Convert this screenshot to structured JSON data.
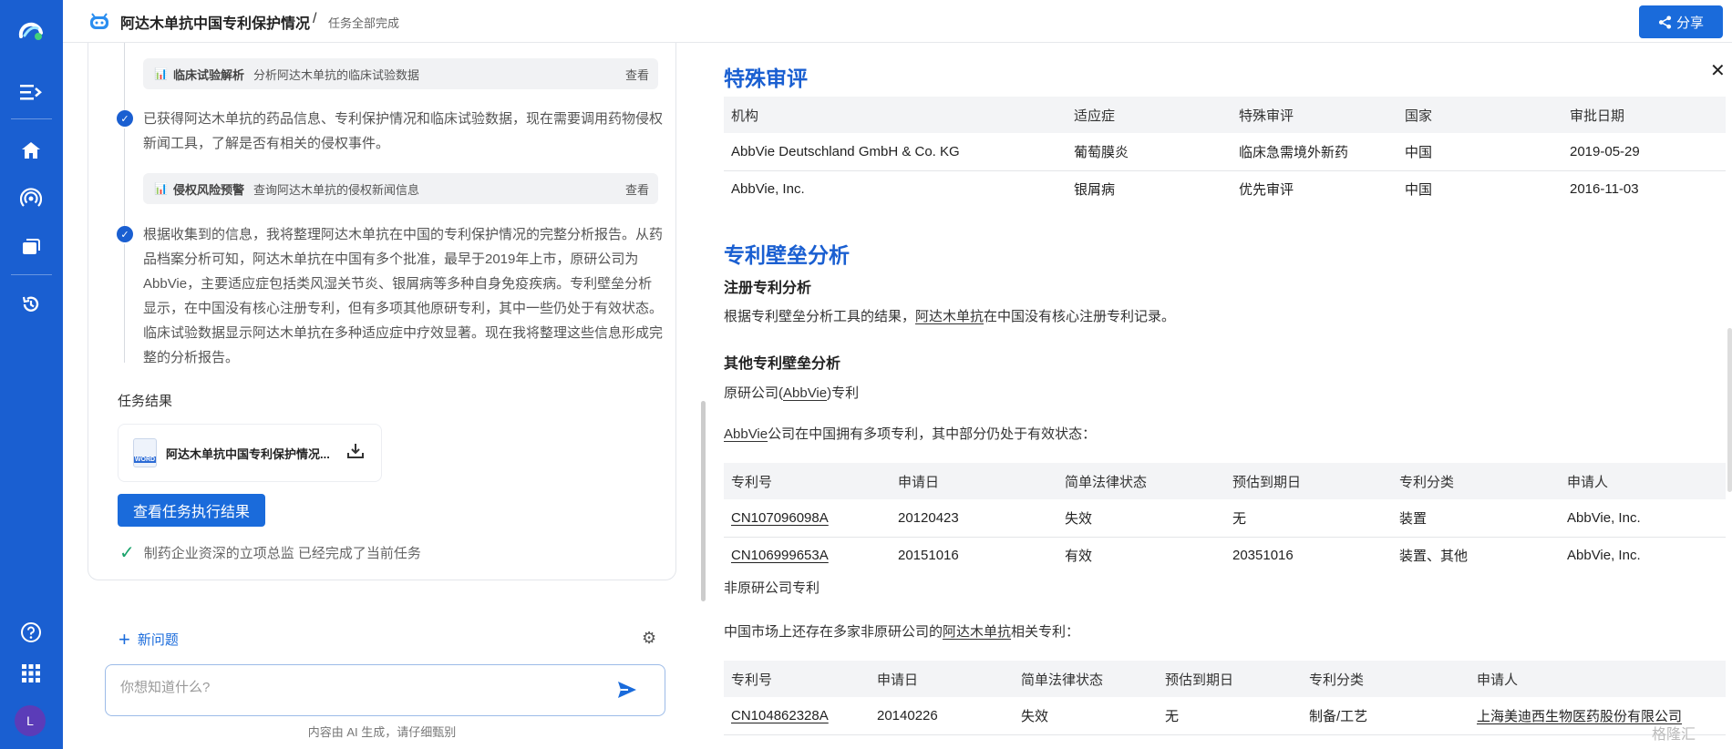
{
  "header": {
    "title": "阿达木单抗中国专利保护情况",
    "separator": "/",
    "status": "任务全部完成",
    "share_label": "分享"
  },
  "sidebar": {
    "items": [
      {
        "icon": "logo-icon"
      },
      {
        "icon": "expand-sidebar-icon"
      },
      {
        "icon": "home-icon"
      },
      {
        "icon": "broadcast-icon"
      },
      {
        "icon": "folders-icon"
      },
      {
        "icon": "history-icon"
      },
      {
        "icon": "help-icon"
      },
      {
        "icon": "apps-grid-icon"
      }
    ],
    "avatar_letter": "L"
  },
  "left": {
    "tool1": {
      "name": "临床试验解析",
      "desc": "分析阿达木单抗的临床试验数据",
      "view": "查看"
    },
    "step1": "已获得阿达木单抗的药品信息、专利保护情况和临床试验数据，现在需要调用药物侵权新闻工具，了解是否有相关的侵权事件。",
    "tool2": {
      "name": "侵权风险预警",
      "desc": "查询阿达木单抗的侵权新闻信息",
      "view": "查看"
    },
    "step2": "根据收集到的信息，我将整理阿达木单抗在中国的专利保护情况的完整分析报告。从药品档案分析可知，阿达木单抗在中国有多个批准，最早于2019年上市，原研公司为AbbVie，主要适应症包括类风湿关节炎、银屑病等多种自身免疫疾病。专利壁垒分析显示，在中国没有核心注册专利，但有多项其他原研专利，其中一些仍处于有效状态。临床试验数据显示阿达木单抗在多种适应症中疗效显著。现在我将整理这些信息形成完整的分析报告。",
    "result_label": "任务结果",
    "file_name": "阿达木单抗中国专利保护情况...",
    "file_type": "WORD",
    "view_result_button": "查看任务执行结果",
    "done_text": "制药企业资深的立项总监 已经完成了当前任务"
  },
  "chat": {
    "new_question": "新问题",
    "placeholder": "你想知道什么?",
    "disclaimer": "内容由 AI 生成，请仔细甄别"
  },
  "report": {
    "special_review_title": "特殊审评",
    "special_review_headers": [
      "机构",
      "适应症",
      "特殊审评",
      "国家",
      "审批日期"
    ],
    "special_review_rows": [
      [
        "AbbVie Deutschland GmbH & Co. KG",
        "葡萄膜炎",
        "临床急需境外新药",
        "中国",
        "2019-05-29"
      ],
      [
        "AbbVie, Inc.",
        "银屑病",
        "优先审评",
        "中国",
        "2016-11-03"
      ]
    ],
    "patent_wall_title": "专利壁垒分析",
    "registered_patent_title": "注册专利分析",
    "registered_patent_text_a": "根据专利壁垒分析工具的结果，",
    "registered_patent_link": "阿达木单抗",
    "registered_patent_text_b": "在中国没有核心注册专利记录。",
    "other_patent_title": "其他专利壁垒分析",
    "originator_label_a": "原研公司(",
    "originator_link": "AbbVie",
    "originator_label_b": ")专利",
    "abbvie_link": "AbbVie",
    "abbvie_text": "公司在中国拥有多项专利，其中部分仍处于有效状态：",
    "patent_headers": [
      "专利号",
      "申请日",
      "简单法律状态",
      "预估到期日",
      "专利分类",
      "申请人"
    ],
    "originator_rows": [
      [
        "CN107096098A",
        "20120423",
        "失效",
        "无",
        "装置",
        "AbbVie, Inc."
      ],
      [
        "CN106999653A",
        "20151016",
        "有效",
        "20351016",
        "装置、其他",
        "AbbVie, Inc."
      ]
    ],
    "non_originator_label": "非原研公司专利",
    "non_originator_text_a": "中国市场上还存在多家非原研公司的",
    "non_originator_link": "阿达木单抗",
    "non_originator_text_b": "相关专利：",
    "non_originator_rows": [
      [
        "CN104862328A",
        "20140226",
        "失效",
        "无",
        "制备/工艺",
        "上海美迪西生物医药股份有限公司"
      ]
    ]
  },
  "watermark": "格隆汇"
}
